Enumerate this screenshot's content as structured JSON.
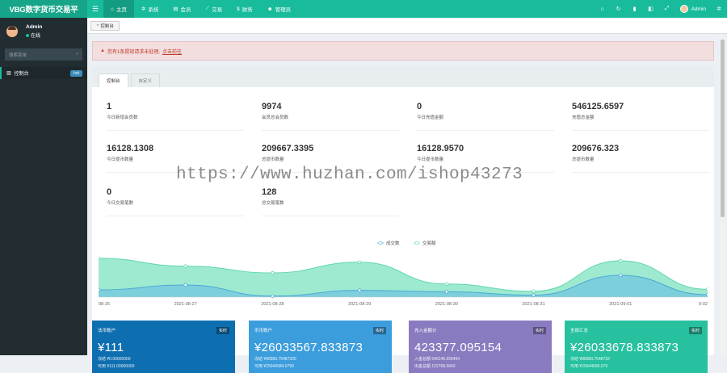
{
  "app": {
    "logo": "VBG数字货币交易平"
  },
  "topnav": {
    "toggle_icon": "hamburger-icon",
    "items": [
      {
        "label": "主页",
        "icon": "home-icon",
        "active": true
      },
      {
        "label": "系统",
        "icon": "cogs-icon"
      },
      {
        "label": "会员",
        "icon": "list-icon"
      },
      {
        "label": "交易",
        "icon": "line-chart-icon"
      },
      {
        "label": "财务",
        "icon": "dollar-icon"
      },
      {
        "label": "管理员",
        "icon": "users-icon"
      }
    ],
    "right_icons": [
      "home-icon",
      "refresh-icon",
      "trash-icon",
      "language-icon",
      "fullscreen-icon"
    ],
    "user": "Admin",
    "settings_icon": "gears-icon"
  },
  "sidebar": {
    "user_name": "Admin",
    "user_status": "在线",
    "search_placeholder": "搜索菜单",
    "items": [
      {
        "label": "控制台",
        "badge": "hot",
        "icon": "bar-chart-icon"
      }
    ]
  },
  "tabbar": {
    "tab": "控制台"
  },
  "alert": {
    "text": "您有1条提现请求未处理,",
    "link": "点击前往"
  },
  "panel_tabs": [
    "控制台",
    "自定义"
  ],
  "stats": [
    {
      "value": "1",
      "label": "今日新增会员数"
    },
    {
      "value": "9974",
      "label": "会员总会员数"
    },
    {
      "value": "0",
      "label": "今日充值金额"
    },
    {
      "value": "546125.6597",
      "label": "充值总金额"
    },
    {
      "value": "16128.1308",
      "label": "今日提币数量"
    },
    {
      "value": "209667.3395",
      "label": "总提币数量"
    },
    {
      "value": "16128.9570",
      "label": "今日提币数量"
    },
    {
      "value": "209676.323",
      "label": "总提币数量"
    },
    {
      "value": "0",
      "label": "今日交易笔数"
    },
    {
      "value": "128",
      "label": "总交易笔数"
    }
  ],
  "chart_data": {
    "type": "area",
    "x": [
      "08-26",
      "2021-08-27",
      "2021-08-28",
      "2021-08-29",
      "2021-08-30",
      "2021-08-31",
      "2021-09-01",
      "9-02"
    ],
    "series": [
      {
        "name": "成交数",
        "color": "#6fc3df",
        "values": [
          15,
          25,
          2,
          14,
          11,
          4,
          45,
          5
        ]
      },
      {
        "name": "交易额",
        "color": "#7de3c0",
        "values": [
          80,
          64,
          50,
          72,
          27,
          12,
          75,
          16
        ]
      }
    ],
    "ylim": [
      0,
      100
    ],
    "legend": "top-center"
  },
  "cards": [
    {
      "title": "法币账户",
      "badge": "实时",
      "value": "¥111",
      "line1": "冻结 ¥0.00000000",
      "line2": "可用 ¥111.00000000",
      "color": "#0e6fb0"
    },
    {
      "title": "币币账户",
      "badge": "实时",
      "value": "¥26033567.833873",
      "line1": "冻结 ¥88983.75487320",
      "line2": "可用 ¥25944584.0790",
      "color": "#3c9ddd"
    },
    {
      "title": "充入金额计",
      "badge": "实时",
      "value": "423377.095154",
      "line1": "入金总额 546145.659454",
      "line2": "出金总额 122768.5643",
      "color": "#8a7bc0"
    },
    {
      "title": "全部汇总",
      "badge": "实时",
      "value": "¥26033678.833873",
      "line1": "冻结 ¥88983.7548732",
      "line2": "可用 ¥25944695.079",
      "color": "#27c1a0"
    }
  ],
  "watermark": "https://www.huzhan.com/ishop43273"
}
